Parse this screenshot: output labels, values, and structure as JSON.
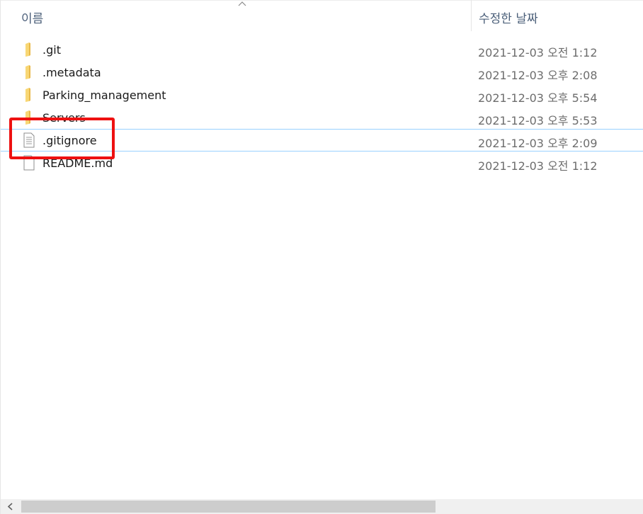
{
  "columns": {
    "name": "이름",
    "date_modified": "수정한 날짜"
  },
  "files": [
    {
      "name": ".git",
      "date": "2021-12-03 오전 1:12",
      "type": "folder"
    },
    {
      "name": ".metadata",
      "date": "2021-12-03 오후 2:08",
      "type": "folder"
    },
    {
      "name": "Parking_management",
      "date": "2021-12-03 오후 5:54",
      "type": "folder"
    },
    {
      "name": "Servers",
      "date": "2021-12-03 오후 5:53",
      "type": "folder"
    },
    {
      "name": ".gitignore",
      "date": "2021-12-03 오후 2:09",
      "type": "file",
      "selected": true
    },
    {
      "name": "README.md",
      "date": "2021-12-03 오전 1:12",
      "type": "file"
    }
  ],
  "icons": {
    "folder": "folder-icon",
    "file": "text-file-icon",
    "sort": "sort-up-icon",
    "scroll_left": "chevron-left-icon"
  },
  "colors": {
    "folder": "#f8d775",
    "selection_border": "#99d1ff",
    "highlight": "#ee1111",
    "header_text": "#4c607a"
  }
}
